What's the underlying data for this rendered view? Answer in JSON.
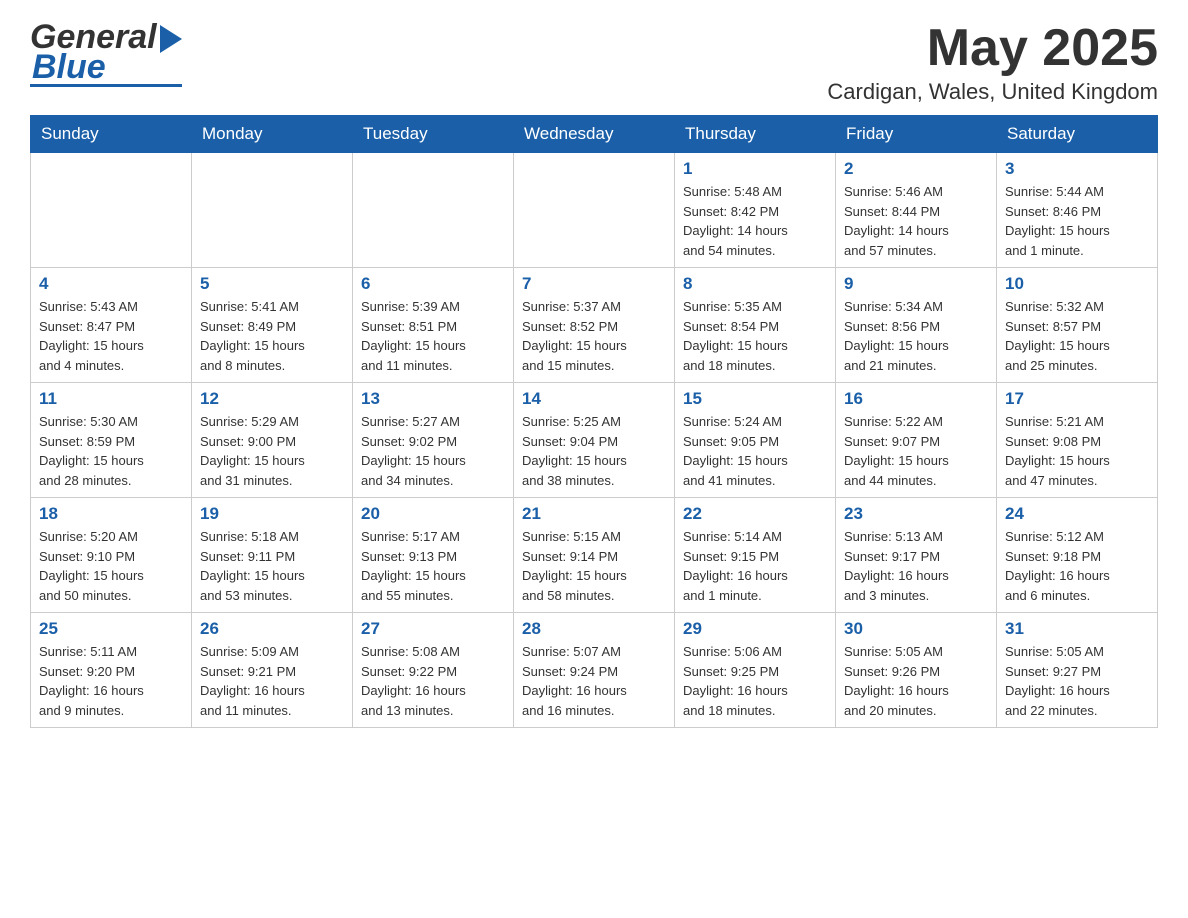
{
  "header": {
    "month_title": "May 2025",
    "location": "Cardigan, Wales, United Kingdom"
  },
  "days_of_week": [
    "Sunday",
    "Monday",
    "Tuesday",
    "Wednesday",
    "Thursday",
    "Friday",
    "Saturday"
  ],
  "weeks": [
    {
      "days": [
        {
          "number": "",
          "info": ""
        },
        {
          "number": "",
          "info": ""
        },
        {
          "number": "",
          "info": ""
        },
        {
          "number": "",
          "info": ""
        },
        {
          "number": "1",
          "info": "Sunrise: 5:48 AM\nSunset: 8:42 PM\nDaylight: 14 hours\nand 54 minutes."
        },
        {
          "number": "2",
          "info": "Sunrise: 5:46 AM\nSunset: 8:44 PM\nDaylight: 14 hours\nand 57 minutes."
        },
        {
          "number": "3",
          "info": "Sunrise: 5:44 AM\nSunset: 8:46 PM\nDaylight: 15 hours\nand 1 minute."
        }
      ]
    },
    {
      "days": [
        {
          "number": "4",
          "info": "Sunrise: 5:43 AM\nSunset: 8:47 PM\nDaylight: 15 hours\nand 4 minutes."
        },
        {
          "number": "5",
          "info": "Sunrise: 5:41 AM\nSunset: 8:49 PM\nDaylight: 15 hours\nand 8 minutes."
        },
        {
          "number": "6",
          "info": "Sunrise: 5:39 AM\nSunset: 8:51 PM\nDaylight: 15 hours\nand 11 minutes."
        },
        {
          "number": "7",
          "info": "Sunrise: 5:37 AM\nSunset: 8:52 PM\nDaylight: 15 hours\nand 15 minutes."
        },
        {
          "number": "8",
          "info": "Sunrise: 5:35 AM\nSunset: 8:54 PM\nDaylight: 15 hours\nand 18 minutes."
        },
        {
          "number": "9",
          "info": "Sunrise: 5:34 AM\nSunset: 8:56 PM\nDaylight: 15 hours\nand 21 minutes."
        },
        {
          "number": "10",
          "info": "Sunrise: 5:32 AM\nSunset: 8:57 PM\nDaylight: 15 hours\nand 25 minutes."
        }
      ]
    },
    {
      "days": [
        {
          "number": "11",
          "info": "Sunrise: 5:30 AM\nSunset: 8:59 PM\nDaylight: 15 hours\nand 28 minutes."
        },
        {
          "number": "12",
          "info": "Sunrise: 5:29 AM\nSunset: 9:00 PM\nDaylight: 15 hours\nand 31 minutes."
        },
        {
          "number": "13",
          "info": "Sunrise: 5:27 AM\nSunset: 9:02 PM\nDaylight: 15 hours\nand 34 minutes."
        },
        {
          "number": "14",
          "info": "Sunrise: 5:25 AM\nSunset: 9:04 PM\nDaylight: 15 hours\nand 38 minutes."
        },
        {
          "number": "15",
          "info": "Sunrise: 5:24 AM\nSunset: 9:05 PM\nDaylight: 15 hours\nand 41 minutes."
        },
        {
          "number": "16",
          "info": "Sunrise: 5:22 AM\nSunset: 9:07 PM\nDaylight: 15 hours\nand 44 minutes."
        },
        {
          "number": "17",
          "info": "Sunrise: 5:21 AM\nSunset: 9:08 PM\nDaylight: 15 hours\nand 47 minutes."
        }
      ]
    },
    {
      "days": [
        {
          "number": "18",
          "info": "Sunrise: 5:20 AM\nSunset: 9:10 PM\nDaylight: 15 hours\nand 50 minutes."
        },
        {
          "number": "19",
          "info": "Sunrise: 5:18 AM\nSunset: 9:11 PM\nDaylight: 15 hours\nand 53 minutes."
        },
        {
          "number": "20",
          "info": "Sunrise: 5:17 AM\nSunset: 9:13 PM\nDaylight: 15 hours\nand 55 minutes."
        },
        {
          "number": "21",
          "info": "Sunrise: 5:15 AM\nSunset: 9:14 PM\nDaylight: 15 hours\nand 58 minutes."
        },
        {
          "number": "22",
          "info": "Sunrise: 5:14 AM\nSunset: 9:15 PM\nDaylight: 16 hours\nand 1 minute."
        },
        {
          "number": "23",
          "info": "Sunrise: 5:13 AM\nSunset: 9:17 PM\nDaylight: 16 hours\nand 3 minutes."
        },
        {
          "number": "24",
          "info": "Sunrise: 5:12 AM\nSunset: 9:18 PM\nDaylight: 16 hours\nand 6 minutes."
        }
      ]
    },
    {
      "days": [
        {
          "number": "25",
          "info": "Sunrise: 5:11 AM\nSunset: 9:20 PM\nDaylight: 16 hours\nand 9 minutes."
        },
        {
          "number": "26",
          "info": "Sunrise: 5:09 AM\nSunset: 9:21 PM\nDaylight: 16 hours\nand 11 minutes."
        },
        {
          "number": "27",
          "info": "Sunrise: 5:08 AM\nSunset: 9:22 PM\nDaylight: 16 hours\nand 13 minutes."
        },
        {
          "number": "28",
          "info": "Sunrise: 5:07 AM\nSunset: 9:24 PM\nDaylight: 16 hours\nand 16 minutes."
        },
        {
          "number": "29",
          "info": "Sunrise: 5:06 AM\nSunset: 9:25 PM\nDaylight: 16 hours\nand 18 minutes."
        },
        {
          "number": "30",
          "info": "Sunrise: 5:05 AM\nSunset: 9:26 PM\nDaylight: 16 hours\nand 20 minutes."
        },
        {
          "number": "31",
          "info": "Sunrise: 5:05 AM\nSunset: 9:27 PM\nDaylight: 16 hours\nand 22 minutes."
        }
      ]
    }
  ]
}
